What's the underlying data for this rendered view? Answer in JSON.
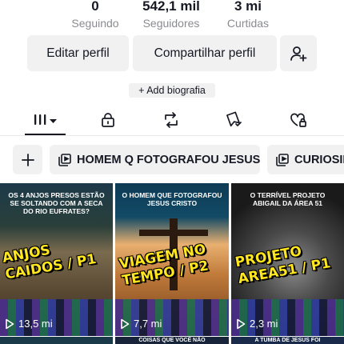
{
  "stats": [
    {
      "value": "0",
      "label": "Seguindo"
    },
    {
      "value": "542,1 mil",
      "label": "Seguidores"
    },
    {
      "value": "3 mi",
      "label": "Curtidas"
    }
  ],
  "actions": {
    "edit_label": "Editar perfil",
    "share_label": "Compartilhar perfil",
    "add_user_icon": "add-user-icon"
  },
  "bio": {
    "add_label": "+ Add biografia"
  },
  "tabs": [
    {
      "name": "videos",
      "icon": "grid-icon",
      "active": true
    },
    {
      "name": "private",
      "icon": "lock-icon"
    },
    {
      "name": "reposts",
      "icon": "repost-icon"
    },
    {
      "name": "saved",
      "icon": "bookmark-icon"
    },
    {
      "name": "liked",
      "icon": "heart-icon"
    }
  ],
  "playlists": [
    {
      "label": "HOMEM Q FOTOGRAFOU JESUS"
    },
    {
      "label": "CURIOSIDADES"
    }
  ],
  "videos": [
    {
      "caption": "OS 4 ANJOS PRESOS ESTÃO SE SOLTANDO COM A SECA DO RIO EUFRATES?",
      "overlay": "ANJOS CAIDOS / P1",
      "views": "13,5 mi",
      "bg": "#6a5a3e"
    },
    {
      "caption": "O HOMEM QUE FOTOGRAFOU JESUS CRISTO",
      "overlay": "VIAGEM NO TEMPO / P2",
      "views": "7,7 mi",
      "bg": "#7a4a22"
    },
    {
      "caption": "O TERRÍVEL PROJETO Abigail DA ÁREA 51",
      "overlay": "PROJETO AREA51 / P1",
      "views": "2,3 mi",
      "bg": "#2a2a2a"
    }
  ],
  "row2": [
    {
      "caption": ""
    },
    {
      "caption": "COISAS QUE VOCÊ NÃO"
    },
    {
      "caption": "A TUMBA DE JESUS FOI"
    }
  ],
  "colors": {
    "accent_text": "#161823",
    "muted": "#8a8b91",
    "button_bg": "#f1f1f2",
    "overlay_yellow": "#ffe61e"
  }
}
